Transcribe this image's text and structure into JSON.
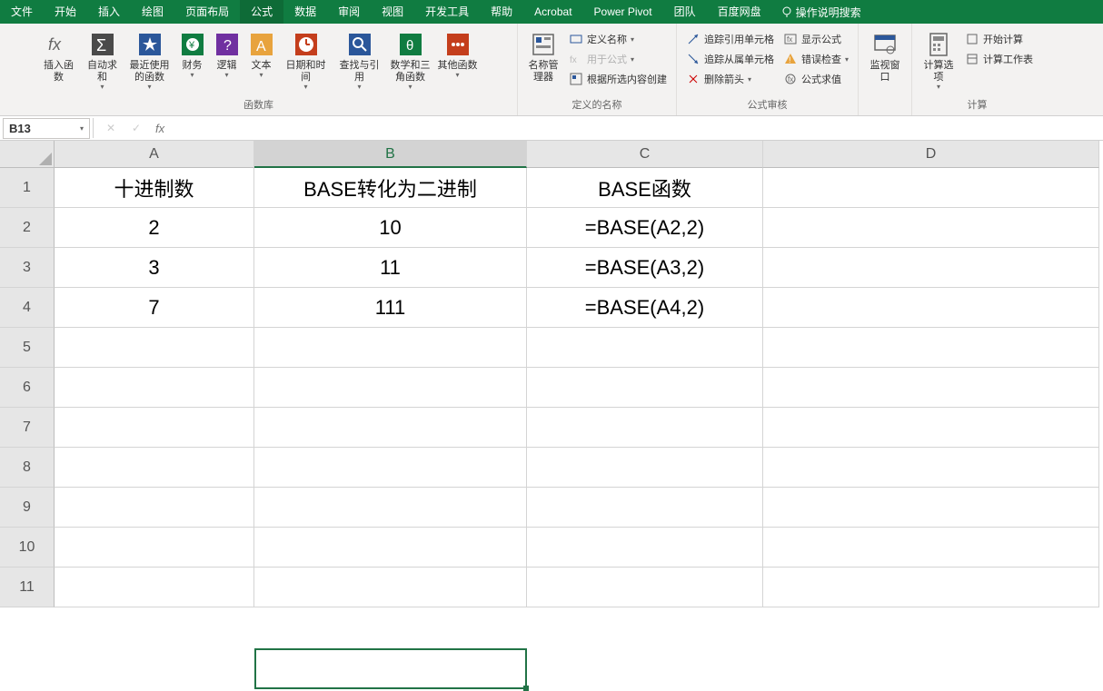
{
  "menubar": {
    "tabs": [
      "文件",
      "开始",
      "插入",
      "绘图",
      "页面布局",
      "公式",
      "数据",
      "审阅",
      "视图",
      "开发工具",
      "帮助",
      "Acrobat",
      "Power Pivot",
      "团队",
      "百度网盘"
    ],
    "active_index": 5,
    "help_search": "操作说明搜索"
  },
  "ribbon": {
    "group_fxlib": {
      "insert_fn": "插入函数",
      "autosum": "自动求和",
      "recent": "最近使用的函数",
      "financial": "财务",
      "logical": "逻辑",
      "text": "文本",
      "datetime": "日期和时间",
      "lookup": "查找与引用",
      "math": "数学和三角函数",
      "more": "其他函数",
      "label": "函数库"
    },
    "group_names": {
      "manager": "名称管理器",
      "define_name": "定义名称",
      "use_in_formula": "用于公式",
      "create_from_sel": "根据所选内容创建",
      "label": "定义的名称"
    },
    "group_audit": {
      "trace_precedents": "追踪引用单元格",
      "trace_dependents": "追踪从属单元格",
      "remove_arrows": "删除箭头",
      "show_formulas": "显示公式",
      "error_check": "错误检查",
      "evaluate": "公式求值",
      "label": "公式审核"
    },
    "group_watch": {
      "watch": "监视窗口"
    },
    "group_calc": {
      "options": "计算选项",
      "calc_now": "开始计算",
      "calc_sheet": "计算工作表",
      "label": "计算"
    }
  },
  "namebox": {
    "ref": "B13"
  },
  "sheet": {
    "columns": [
      "A",
      "B",
      "C",
      "D"
    ],
    "rows": [
      "1",
      "2",
      "3",
      "4",
      "5",
      "6",
      "7",
      "8",
      "9",
      "10",
      "11"
    ],
    "data": [
      [
        "十进制数",
        "BASE转化为二进制",
        "BASE函数",
        ""
      ],
      [
        "2",
        "10",
        "=BASE(A2,2)",
        ""
      ],
      [
        "3",
        "11",
        "=BASE(A3,2)",
        ""
      ],
      [
        "7",
        "111",
        "=BASE(A4,2)",
        ""
      ],
      [
        "",
        "",
        "",
        ""
      ],
      [
        "",
        "",
        "",
        ""
      ],
      [
        "",
        "",
        "",
        ""
      ],
      [
        "",
        "",
        "",
        ""
      ],
      [
        "",
        "",
        "",
        ""
      ],
      [
        "",
        "",
        "",
        ""
      ],
      [
        "",
        "",
        "",
        ""
      ]
    ],
    "selected_col_index": 1
  }
}
